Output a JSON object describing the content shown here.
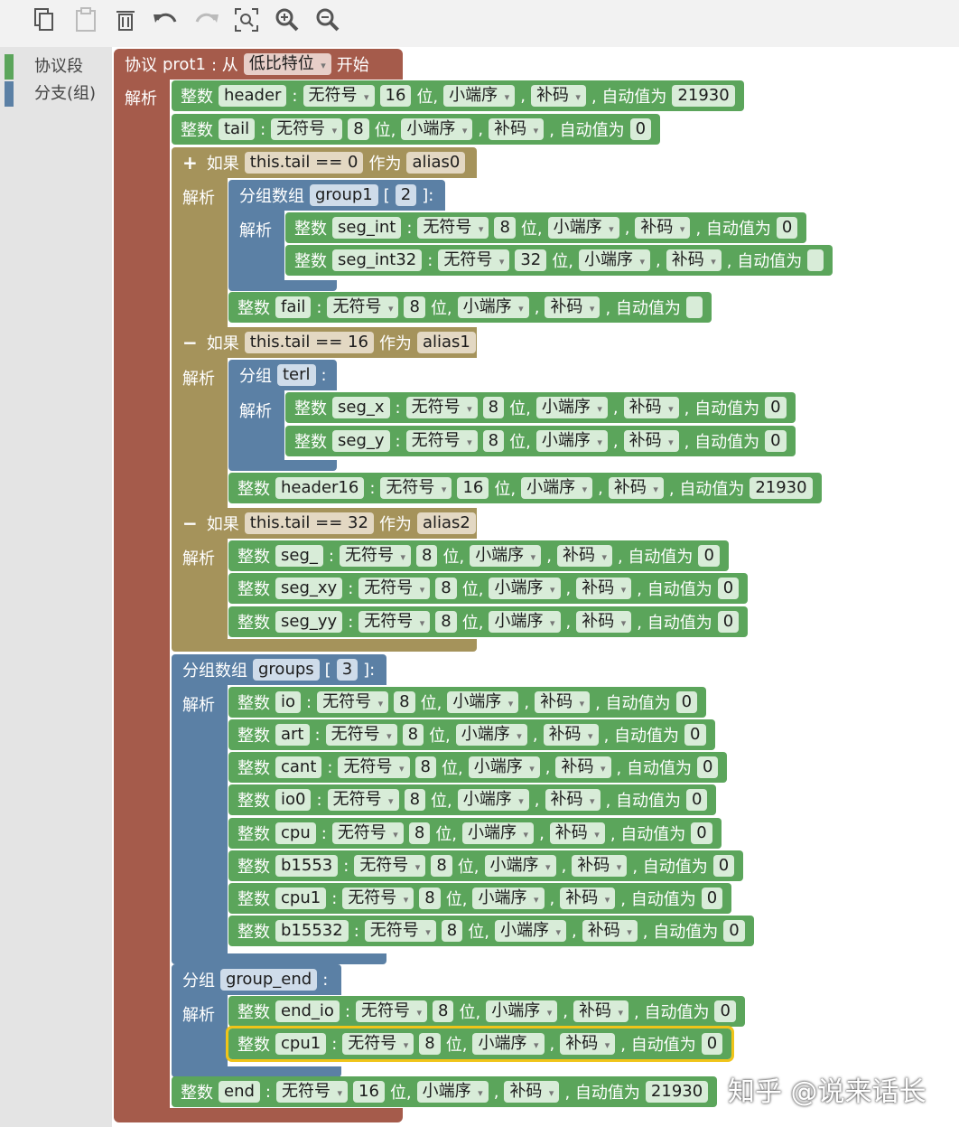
{
  "toolbar": {
    "icons": [
      "copy-icon",
      "paste-icon",
      "delete-icon",
      "undo-icon",
      "redo-icon",
      "zoom-fit-icon",
      "zoom-in-icon",
      "zoom-out-icon"
    ]
  },
  "toolbox": {
    "items": [
      {
        "label": "协议段",
        "color": "#5ba55b"
      },
      {
        "label": "分支(组)",
        "color": "#5b80a5"
      }
    ]
  },
  "common": {
    "int_kw": "整数",
    "colon": ":",
    "unsigned": "无符号",
    "bits": "位,",
    "endian": "小端序",
    "comma": ",",
    "comp": "补码",
    "auto": ", 自动值为",
    "parse": "解析",
    "if_kw": "如果",
    "as_kw": "作为",
    "group": "分组",
    "group_array": "分组数组",
    "lb": "[",
    "rb": "]:"
  },
  "protocol": {
    "keyword": "协议",
    "name": "prot1",
    "from": ": 从",
    "bit_order": "低比特位",
    "start": "开始"
  },
  "fields": {
    "header": {
      "name": "header",
      "bits": "16",
      "auto": "21930"
    },
    "tail": {
      "name": "tail",
      "bits": "8",
      "auto": "0"
    },
    "seg_int": {
      "name": "seg_int",
      "bits": "8",
      "auto": "0"
    },
    "seg_int32": {
      "name": "seg_int32",
      "bits": "32",
      "auto": ""
    },
    "fail": {
      "name": "fail",
      "bits": "8",
      "auto": ""
    },
    "seg_x": {
      "name": "seg_x",
      "bits": "8",
      "auto": "0"
    },
    "seg_y": {
      "name": "seg_y",
      "bits": "8",
      "auto": "0"
    },
    "header16": {
      "name": "header16",
      "bits": "16",
      "auto": "21930"
    },
    "seg_": {
      "name": "seg_",
      "bits": "8",
      "auto": "0"
    },
    "seg_xy": {
      "name": "seg_xy",
      "bits": "8",
      "auto": "0"
    },
    "seg_yy": {
      "name": "seg_yy",
      "bits": "8",
      "auto": "0"
    },
    "io": {
      "name": "io",
      "bits": "8",
      "auto": "0"
    },
    "art": {
      "name": "art",
      "bits": "8",
      "auto": "0"
    },
    "cant": {
      "name": "cant",
      "bits": "8",
      "auto": "0"
    },
    "io0": {
      "name": "io0",
      "bits": "8",
      "auto": "0"
    },
    "cpu": {
      "name": "cpu",
      "bits": "8",
      "auto": "0"
    },
    "b1553": {
      "name": "b1553",
      "bits": "8",
      "auto": "0"
    },
    "cpu1": {
      "name": "cpu1",
      "bits": "8",
      "auto": "0"
    },
    "b15532": {
      "name": "b15532",
      "bits": "8",
      "auto": "0"
    },
    "end_io": {
      "name": "end_io",
      "bits": "8",
      "auto": "0"
    },
    "cpu1b": {
      "name": "cpu1",
      "bits": "8",
      "auto": "0"
    },
    "end": {
      "name": "end",
      "bits": "16",
      "auto": "21930"
    }
  },
  "branches": [
    {
      "toggle": "+",
      "cond": "this.tail == 0",
      "alias": "alias0"
    },
    {
      "toggle": "−",
      "cond": "this.tail == 16",
      "alias": "alias1"
    },
    {
      "toggle": "−",
      "cond": "this.tail == 32",
      "alias": "alias2"
    }
  ],
  "groups": {
    "group1": {
      "name": "group1",
      "count": "2"
    },
    "terl": {
      "name": "terl"
    },
    "groups": {
      "name": "groups",
      "count": "3"
    },
    "group_end": {
      "name": "group_end"
    }
  },
  "watermark": "知乎 @说来话长"
}
